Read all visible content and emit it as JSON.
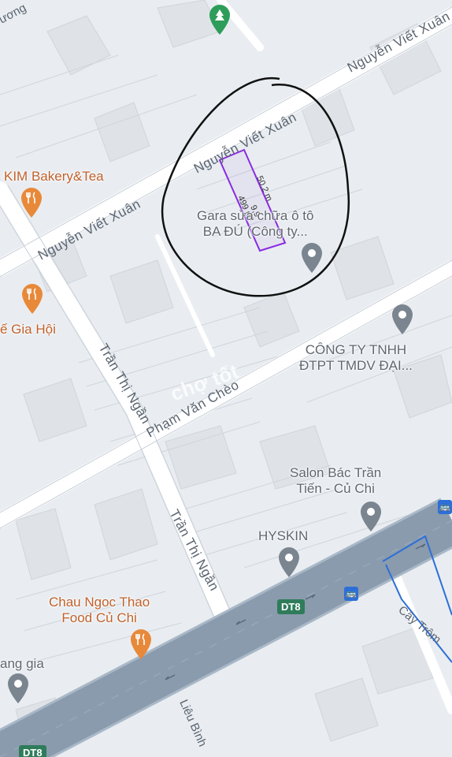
{
  "map": {
    "streets": {
      "nguyen_viet_xuan_1": "Nguyễn Viết Xuân",
      "nguyen_viet_xuan_2": "Nguyễn Viết Xuân",
      "nguyen_viet_xuan_3": "Nguyễn Viết Xuân",
      "tran_thi_ngan_1": "Trần Thị Ngần",
      "tran_thi_ngan_2": "Trần Thị Ngần",
      "pham_van_cheo": "Phạm Văn Chèo",
      "lieu_binh": "Liêu Bình",
      "cay_tron": "Cây Trôm",
      "top_left": "ương"
    },
    "road_badges": [
      "DT8",
      "DT8"
    ],
    "pois": {
      "kim_bakery": "KIM Bakery&Tea",
      "ca_phe_gia_hoi": "ế Gia Hội",
      "gara": [
        "Gara sửa chữa ô tô",
        "BA ĐÚ (Công ty..."
      ],
      "cong_ty": [
        "CÔNG TY TNHH",
        "ĐTPT TMDV ĐẠI..."
      ],
      "salon": [
        "Salon Bác Trần",
        "Tiến - Củ Chi"
      ],
      "hyskin": "HYSKIN",
      "chau_ngoc_thao": [
        "Chau Ngoc Thao",
        "Food Củ Chi"
      ],
      "sang_gia": "ang gia"
    },
    "parcel": {
      "length_label": "50,2 m",
      "area_label": "499 m²",
      "width_label": "9,9"
    },
    "watermark": "chợ tốt",
    "colors": {
      "background": "#e9edf1",
      "road": "#ffffff",
      "highway": "#8a9bad",
      "parcel_outline": "#8a2be2",
      "circle": "#111111",
      "poi_orange": "#e8893a",
      "poi_gray": "#7a8590",
      "park_green": "#2e9d5a",
      "transit_blue": "#2d6fd6"
    }
  }
}
